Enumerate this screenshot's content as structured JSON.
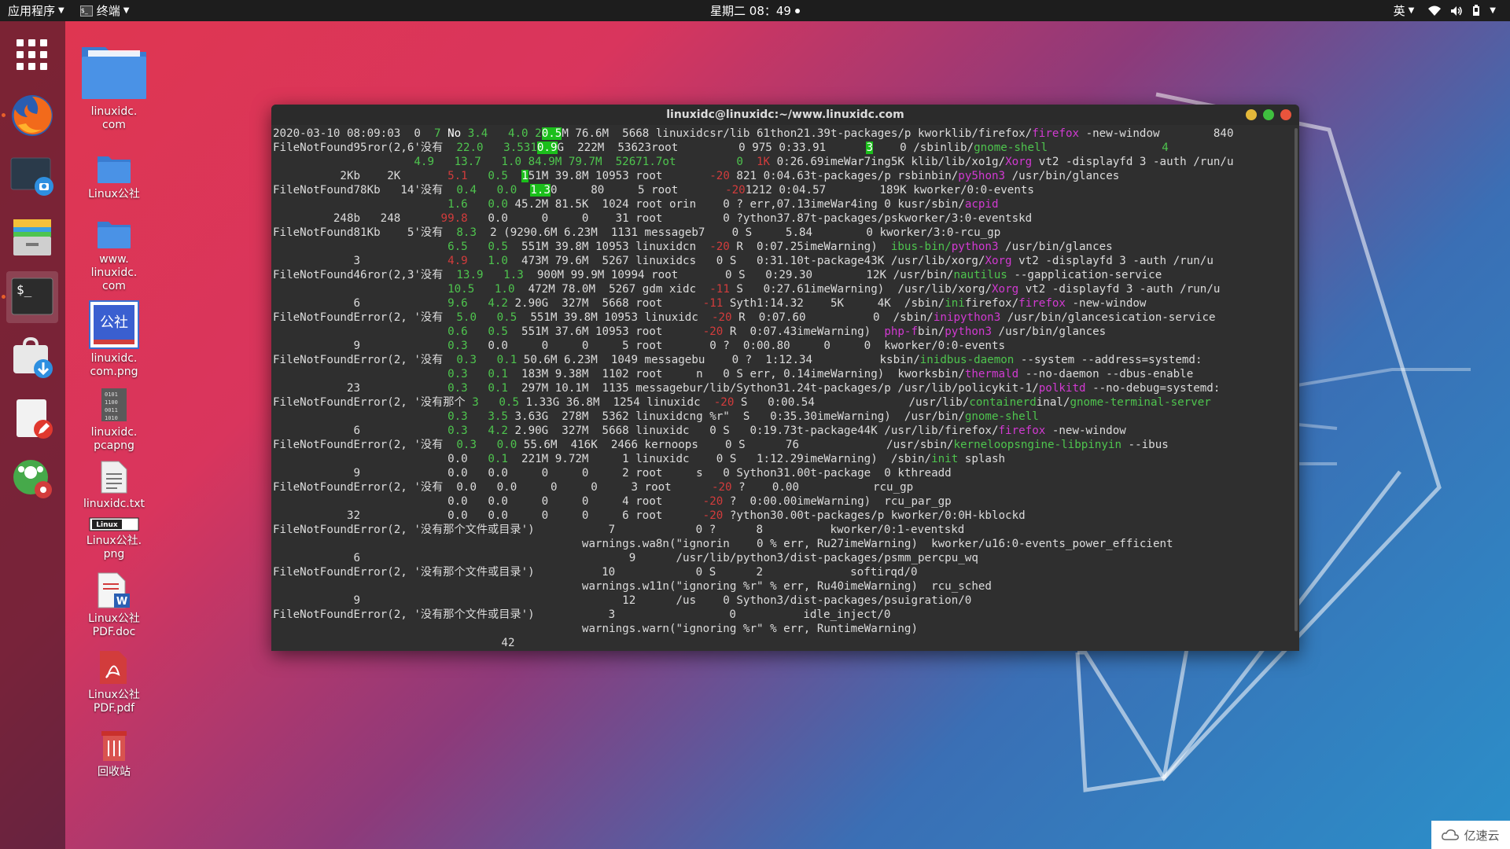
{
  "topbar": {
    "apps_menu": "应用程序",
    "terminal_menu": "终端",
    "clock": "星期二 08：49",
    "input_method": "英"
  },
  "dock": {
    "items": [
      "app-grid",
      "firefox",
      "screenshot",
      "files",
      "terminal",
      "software-install",
      "text-editor",
      "settings"
    ]
  },
  "desktop": {
    "icons": [
      {
        "label": "linuxidc.\ncom",
        "icon": "folder-icon"
      },
      {
        "label": "Linux公社",
        "icon": "folder-icon"
      },
      {
        "label": "www.\nlinuxidc.\ncom",
        "icon": "folder-icon"
      },
      {
        "label": "linuxidc.\ncom.png",
        "icon": "image-icon"
      },
      {
        "label": "linuxidc.\npcapng",
        "icon": "binary-file-icon"
      },
      {
        "label": "linuxidc.txt",
        "icon": "text-file-icon"
      },
      {
        "label": "Linux公社.\npng",
        "icon": "image-icon"
      },
      {
        "label": "Linux公社\nPDF.doc",
        "icon": "word-doc-icon"
      },
      {
        "label": "Linux公社\nPDF.pdf",
        "icon": "pdf-icon"
      },
      {
        "label": "回收站",
        "icon": "trash-icon"
      }
    ]
  },
  "terminal": {
    "title": "linuxidc@linuxidc:~/www.linuxidc.com",
    "lines": [
      [
        [
          "2020-03-10 08:09:03  0  ",
          "#dcdcdc"
        ],
        [
          "7 ",
          "#4ec44e"
        ],
        [
          "No ",
          "#ffffff"
        ],
        [
          "3.4",
          "#4ec44e"
        ],
        [
          "   4.0 2",
          "#4ec44e"
        ],
        [
          "0.5",
          "#ffffff",
          "#1bbf1b"
        ],
        [
          "M 76.6M  5668 linuxidcsr/lib 61thon21.39t-packages/p kworklib/firefox/",
          "#dcdcdc"
        ],
        [
          "firefox",
          "#d13ad1"
        ],
        [
          " -new-window        840",
          "#dcdcdc"
        ]
      ],
      [
        [
          "FileNotFound95ror(2,6'没有  ",
          "#dcdcdc"
        ],
        [
          "22.0",
          "#4ec44e"
        ],
        [
          "   3.531",
          "#4ec44e"
        ],
        [
          "0.9",
          "#ffffff",
          "#1bbf1b"
        ],
        [
          "G  222M  53623root         0 975 0:33.91      ",
          "#dcdcdc"
        ],
        [
          "3",
          "#ffffff",
          "#1bbf1b"
        ],
        [
          "    0 /sbinlib/",
          "#dcdcdc"
        ],
        [
          "gnome-shell",
          "#4ec44e"
        ],
        [
          "                 4",
          "#4ec44e"
        ]
      ],
      [
        [
          "                     ",
          "#dcdcdc"
        ],
        [
          "4.9",
          "#4ec44e"
        ],
        [
          "   13.7   1.0 84.9M 79.7M  52671.7ot         0  ",
          "#4ec44e"
        ],
        [
          "1K",
          "#d23c3c"
        ],
        [
          " 0:26.69imeWar7ing5K klib/lib/xo1g/",
          "#dcdcdc"
        ],
        [
          "Xorg",
          "#d13ad1"
        ],
        [
          " vt2 -displayfd 3 -auth /run/u",
          "#dcdcdc"
        ]
      ],
      [
        [
          "          2Kb    2K       ",
          "#dcdcdc"
        ],
        [
          "5.1",
          "#d23c3c"
        ],
        [
          "   0.5  ",
          "#4ec44e"
        ],
        [
          "1",
          "#ffffff",
          "#1bbf1b"
        ],
        [
          "51M 39.8M 10953 root       ",
          "#dcdcdc"
        ],
        [
          "-20",
          "#d23c3c"
        ],
        [
          " 821 0:04.63t-packages/p rsbinbin/",
          "#dcdcdc"
        ],
        [
          "py5hon3",
          "#d13ad1"
        ],
        [
          " /usr/bin/glances",
          "#dcdcdc"
        ]
      ],
      [
        [
          "FileNotFound78Kb   14'没有  ",
          "#dcdcdc"
        ],
        [
          "0.4",
          "#4ec44e"
        ],
        [
          "   0.0  ",
          "#4ec44e"
        ],
        [
          "1.3",
          "#ffffff",
          "#1bbf1b"
        ],
        [
          "0     80     5 root       ",
          "#dcdcdc"
        ],
        [
          "-20",
          "#d23c3c"
        ],
        [
          "1212 0:04.57        189K kworker/0:0-events",
          "#dcdcdc"
        ]
      ],
      [
        [
          "                          ",
          "#dcdcdc"
        ],
        [
          "1.6   0.0",
          "#4ec44e"
        ],
        [
          " 45.2M 81.5K  1024 root orin    0 ? err,07.13imeWar4ing 0 kusr/sbin/",
          "#dcdcdc"
        ],
        [
          "acpid",
          "#d13ad1"
        ]
      ],
      [
        [
          "         248b   248      ",
          "#dcdcdc"
        ],
        [
          "99.8",
          "#d23c3c"
        ],
        [
          "   0.0     0     0    31 root         0 ?ython37.87t-packages/pskworker/3:0-eventskd",
          "#dcdcdc"
        ]
      ],
      [
        [
          "FileNotFound81Kb    5'没有  ",
          "#dcdcdc"
        ],
        [
          "8.3",
          "#4ec44e"
        ],
        [
          "  2 (9290.6M 6.23M  1131 messageb7    0 S     5.84        0 kworker/3:0-rcu_gp",
          "#dcdcdc"
        ]
      ],
      [
        [
          "                          ",
          "#dcdcdc"
        ],
        [
          "6.5   0.5",
          "#4ec44e"
        ],
        [
          "  551M 39.8M 10953 linuxidcn  ",
          "#dcdcdc"
        ],
        [
          "-20",
          "#d23c3c"
        ],
        [
          " R  0:07.25imeWarning)  ",
          "#dcdcdc"
        ],
        [
          "ibus-bin/",
          "#4ec44e"
        ],
        [
          "python3",
          "#d13ad1"
        ],
        [
          " /usr/bin/glances",
          "#dcdcdc"
        ]
      ],
      [
        [
          "            3             ",
          "#dcdcdc"
        ],
        [
          "4.9",
          "#d23c3c"
        ],
        [
          "   1.0",
          "#4ec44e"
        ],
        [
          "  473M 79.6M  5267 linuxidcs   0 S   0:31.10t-package43K /usr/lib/xorg/",
          "#dcdcdc"
        ],
        [
          "Xorg",
          "#d13ad1"
        ],
        [
          " vt2 -displayfd 3 -auth /run/u",
          "#dcdcdc"
        ]
      ],
      [
        [
          "FileNotFound46ror(2,3'没有  ",
          "#dcdcdc"
        ],
        [
          "13.9   1.3",
          "#4ec44e"
        ],
        [
          "  900M 99.9M 10994 root       0 S   0:29.30        12K /usr/bin/",
          "#dcdcdc"
        ],
        [
          "nautilus",
          "#4ec44e"
        ],
        [
          " --gapplication-service",
          "#dcdcdc"
        ]
      ],
      [
        [
          "                          ",
          "#dcdcdc"
        ],
        [
          "10.5   1.0",
          "#4ec44e"
        ],
        [
          "  472M 78.0M  5267 gdm xidc  ",
          "#dcdcdc"
        ],
        [
          "-11",
          "#d23c3c"
        ],
        [
          " S   0:27.61imeWarning)  /usr/lib/xorg/",
          "#dcdcdc"
        ],
        [
          "Xorg",
          "#d13ad1"
        ],
        [
          " vt2 -displayfd 3 -auth /run/u",
          "#dcdcdc"
        ]
      ],
      [
        [
          "            6             ",
          "#dcdcdc"
        ],
        [
          "9.6   4.2",
          "#4ec44e"
        ],
        [
          " 2.90G  327M  5668 root      ",
          "#dcdcdc"
        ],
        [
          "-11",
          "#d23c3c"
        ],
        [
          " Syth1:14.32    5K     4K  /sbin/",
          "#dcdcdc"
        ],
        [
          "ini",
          "#4ec44e"
        ],
        [
          "firefox/",
          "#dcdcdc"
        ],
        [
          "firefox",
          "#d13ad1"
        ],
        [
          " -new-window",
          "#dcdcdc"
        ]
      ],
      [
        [
          "FileNotFoundError(2, '没有  ",
          "#dcdcdc"
        ],
        [
          "5.0   0.5",
          "#4ec44e"
        ],
        [
          "  551M 39.8M 10953 linuxidc  ",
          "#dcdcdc"
        ],
        [
          "-20",
          "#d23c3c"
        ],
        [
          " R  0:07.60          0  /sbin/",
          "#dcdcdc"
        ],
        [
          "inipython3",
          "#d13ad1"
        ],
        [
          " /usr/bin/glancesication-service",
          "#dcdcdc"
        ]
      ],
      [
        [
          "                          ",
          "#dcdcdc"
        ],
        [
          "0.6   0.5",
          "#4ec44e"
        ],
        [
          "  551M 37.6M 10953 root      ",
          "#dcdcdc"
        ],
        [
          "-20",
          "#d23c3c"
        ],
        [
          " R  0:07.43imeWarning)  ",
          "#dcdcdc"
        ],
        [
          "php-f",
          "#d13ad1"
        ],
        [
          "bin/",
          "#dcdcdc"
        ],
        [
          "python3",
          "#d13ad1"
        ],
        [
          " /usr/bin/glances",
          "#dcdcdc"
        ]
      ],
      [
        [
          "            9             ",
          "#dcdcdc"
        ],
        [
          "0.3",
          "#4ec44e"
        ],
        [
          "   0.0     0     0     5 root       0 ?  0:00.80     0     0  kworker/0:0-events",
          "#dcdcdc"
        ]
      ],
      [
        [
          "FileNotFoundError(2, '没有  ",
          "#dcdcdc"
        ],
        [
          "0.3   0.1",
          "#4ec44e"
        ],
        [
          " 50.6M 6.23M  1049 messagebu    0 ?  1:12.34          ksbin/",
          "#dcdcdc"
        ],
        [
          "inidbus-daemon",
          "#4ec44e"
        ],
        [
          " --system --address=systemd:",
          "#dcdcdc"
        ]
      ],
      [
        [
          "                          ",
          "#dcdcdc"
        ],
        [
          "0.3   0.1",
          "#4ec44e"
        ],
        [
          "  183M 9.38M  1102 root     n   0 S err, 0.14imeWarning)  kworksbin/",
          "#dcdcdc"
        ],
        [
          "thermald",
          "#d13ad1"
        ],
        [
          " --no-daemon --dbus-enable",
          "#dcdcdc"
        ]
      ],
      [
        [
          "           23             ",
          "#dcdcdc"
        ],
        [
          "0.3   0.1",
          "#4ec44e"
        ],
        [
          "  297M 10.1M  1135 messagebur/lib/Sython31.24t-packages/p /usr/lib/policykit-1/",
          "#dcdcdc"
        ],
        [
          "polkitd",
          "#d13ad1"
        ],
        [
          " --no-debug=systemd:",
          "#dcdcdc"
        ]
      ],
      [
        [
          "FileNotFoundError(2, '没有那个 ",
          "#dcdcdc"
        ],
        [
          "3   0.5",
          "#4ec44e"
        ],
        [
          " 1.33G 36.8M  1254 linuxidc  ",
          "#dcdcdc"
        ],
        [
          "-20",
          "#d23c3c"
        ],
        [
          " S   0:00.54              /usr/lib/",
          "#dcdcdc"
        ],
        [
          "containerd",
          "#4ec44e"
        ],
        [
          "inal/",
          "#dcdcdc"
        ],
        [
          "gnome-terminal-server",
          "#4ec44e"
        ]
      ],
      [
        [
          "                          ",
          "#dcdcdc"
        ],
        [
          "0.3   3.5",
          "#4ec44e"
        ],
        [
          " 3.63G  278M  5362 linuxidcng %r\"  S   0:35.30imeWarning)  /usr/bin/",
          "#dcdcdc"
        ],
        [
          "gnome-shell",
          "#4ec44e"
        ]
      ],
      [
        [
          "            6             ",
          "#dcdcdc"
        ],
        [
          "0.3   4.2",
          "#4ec44e"
        ],
        [
          " 2.90G  327M  5668 linuxidc   0 S   0:19.73t-package44K /usr/lib/firefox/",
          "#dcdcdc"
        ],
        [
          "firefox",
          "#d13ad1"
        ],
        [
          " -new-window",
          "#dcdcdc"
        ]
      ],
      [
        [
          "FileNotFoundError(2, '没有  ",
          "#dcdcdc"
        ],
        [
          "0.3   0.0",
          "#4ec44e"
        ],
        [
          " 55.6M  416K  2466 kernoops    0 S      76             /usr/sbin/",
          "#dcdcdc"
        ],
        [
          "kerneloopsngine-libpinyin",
          "#4ec44e"
        ],
        [
          " --ibus",
          "#dcdcdc"
        ]
      ],
      [
        [
          "                          0.0   ",
          "#dcdcdc"
        ],
        [
          "0.1",
          "#4ec44e"
        ],
        [
          "  221M 9.72M     1 linuxidc    0 S   1:12.29imeWarning)  /sbin/",
          "#dcdcdc"
        ],
        [
          "init",
          "#4ec44e"
        ],
        [
          " splash",
          "#dcdcdc"
        ]
      ],
      [
        [
          "            9             0.0   0.0     0     0     2 root     s   0 Sython31.00t-package  0 kthreadd",
          "#dcdcdc"
        ]
      ],
      [
        [
          "FileNotFoundError(2, '没有  0.0   0.0     0     0     3 root      ",
          "#dcdcdc"
        ],
        [
          "-20",
          "#d23c3c"
        ],
        [
          " ?    0.00           rcu_gp",
          "#dcdcdc"
        ]
      ],
      [
        [
          "                          0.0   0.0     0     0     4 root      ",
          "#dcdcdc"
        ],
        [
          "-20",
          "#d23c3c"
        ],
        [
          " ?  0:00.00imeWarning)  rcu_par_gp",
          "#dcdcdc"
        ]
      ],
      [
        [
          "           32             0.0   0.0     0     0     6 root      ",
          "#dcdcdc"
        ],
        [
          "-20",
          "#d23c3c"
        ],
        [
          " ?ython30.00t-packages/p kworker/0:0H-kblockd",
          "#dcdcdc"
        ]
      ],
      [
        [
          "FileNotFoundError(2, '没有那个文件或目录')           7            0 ?      8          kworker/0:1-eventskd",
          "#dcdcdc"
        ]
      ],
      [
        [
          "                                              warnings.wa8n(\"ignorin    0 % err, Ru27imeWarning)  kworker/u16:0-events_power_efficient",
          "#dcdcdc"
        ]
      ],
      [
        [
          "            6                                        9      /usr/lib/python3/dist-packages/psmm_percpu_wq",
          "#dcdcdc"
        ]
      ],
      [
        [
          "FileNotFoundError(2, '没有那个文件或目录')          10            0 S      2             softirqd/0",
          "#dcdcdc"
        ]
      ],
      [
        [
          "                                              warnings.w11n(\"ignoring %r\" % err, Ru40imeWarning)  rcu_sched",
          "#dcdcdc"
        ]
      ],
      [
        [
          "            9                                       12      /us    0 Sython3/dist-packages/psuigration/0",
          "#dcdcdc"
        ]
      ],
      [
        [
          "FileNotFoundError(2, '没有那个文件或目录')           3                 0          idle_inject/0",
          "#dcdcdc"
        ]
      ],
      [
        [
          "                                              warnings.warn(\"ignoring %r\" % err, RuntimeWarning)",
          "#dcdcdc"
        ]
      ],
      [
        [
          "                                  42",
          "#dcdcdc"
        ]
      ]
    ]
  },
  "watermark": {
    "text": "亿速云"
  },
  "colors": {
    "topbar_bg": "#1d1d1d",
    "terminal_bg": "#2f2f2f",
    "term_green": "#4ec44e",
    "term_red": "#d23c3c",
    "term_magenta": "#d13ad1",
    "close_btn": "#e9543c",
    "max_btn": "#3fbf3f",
    "min_btn": "#e4b83a"
  }
}
